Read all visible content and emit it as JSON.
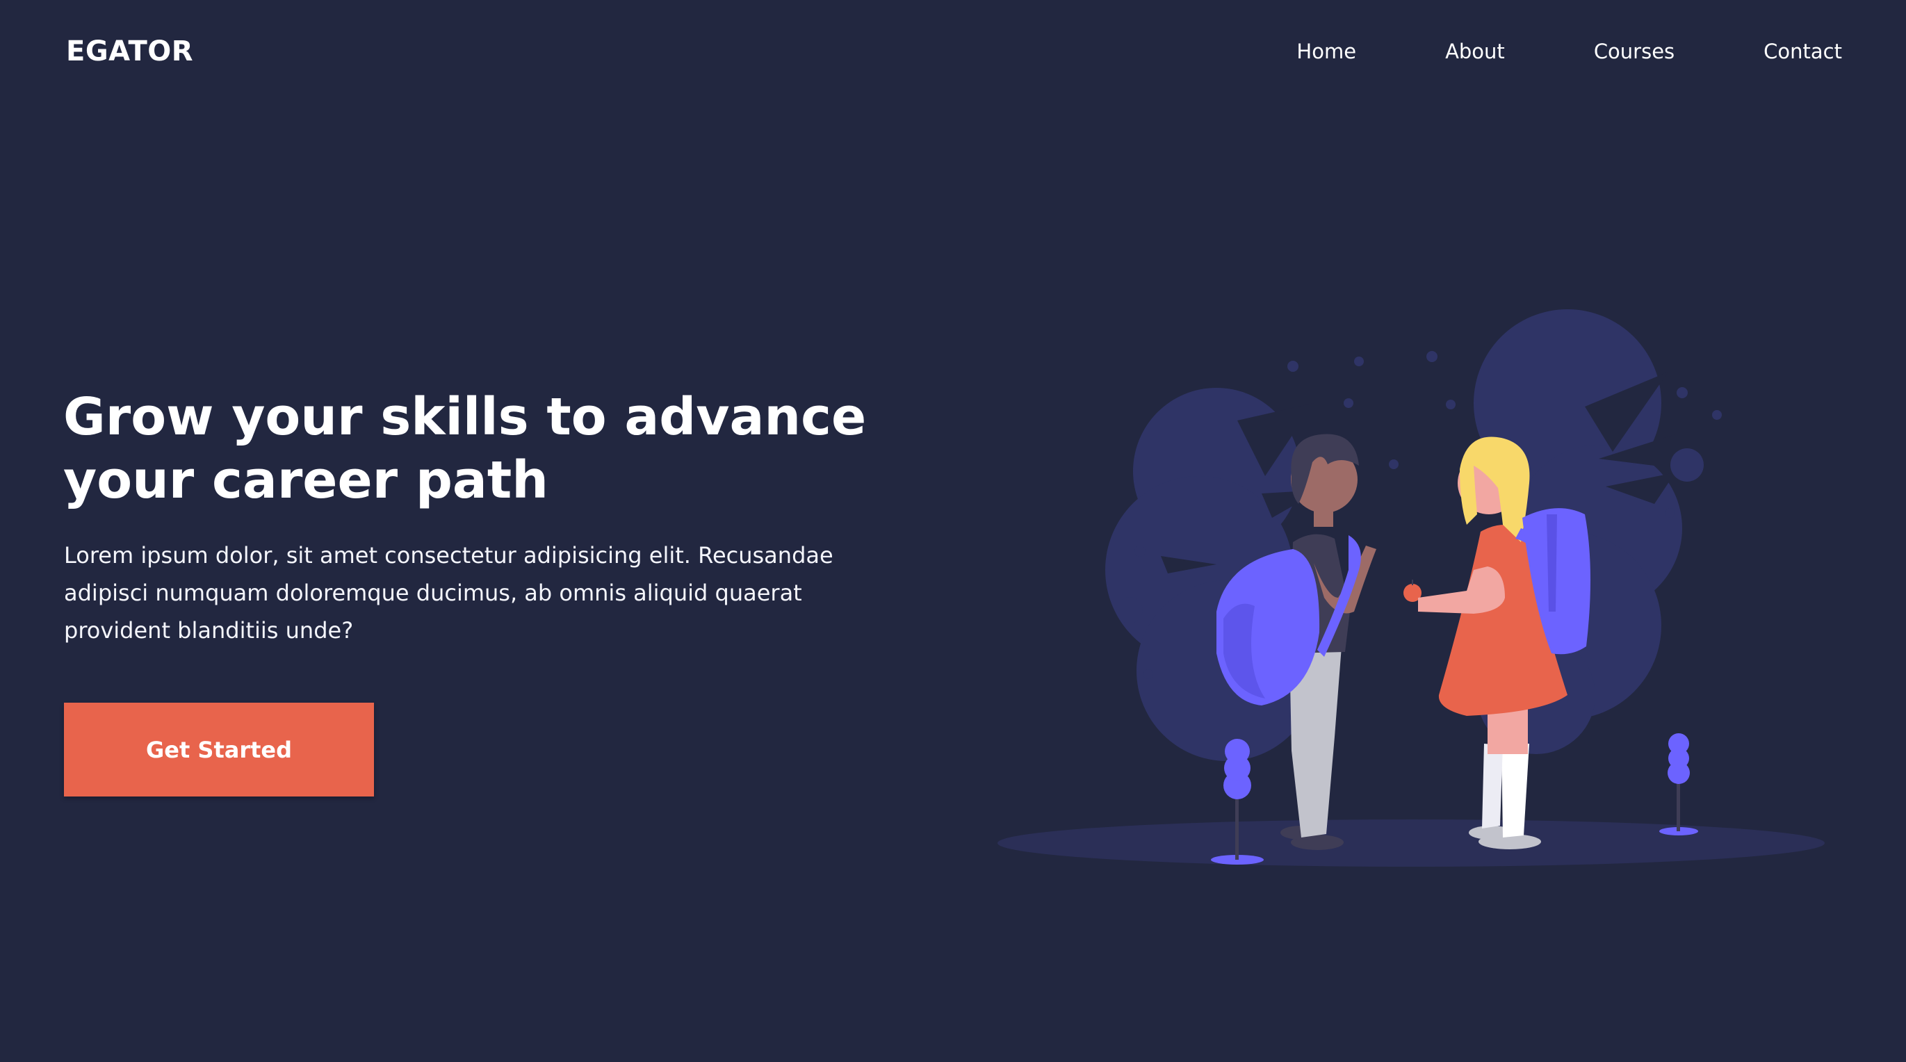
{
  "header": {
    "logo": "EGATOR",
    "nav": [
      {
        "label": "Home"
      },
      {
        "label": "About"
      },
      {
        "label": "Courses"
      },
      {
        "label": "Contact"
      }
    ]
  },
  "hero": {
    "title": "Grow your skills to advance your career path",
    "description": "Lorem ipsum dolor, sit amet consectetur adipisicing elit. Recusandae adipisci numquam doloremque ducimus, ab omnis aliquid quaerat provident blanditiis unde?",
    "cta_label": "Get Started"
  },
  "illustration": {
    "name": "students-with-backpacks-illustration"
  },
  "colors": {
    "background": "#222740",
    "accent": "#e8644c",
    "illustration_primary": "#6c63ff",
    "illustration_bush": "#2f3466"
  }
}
